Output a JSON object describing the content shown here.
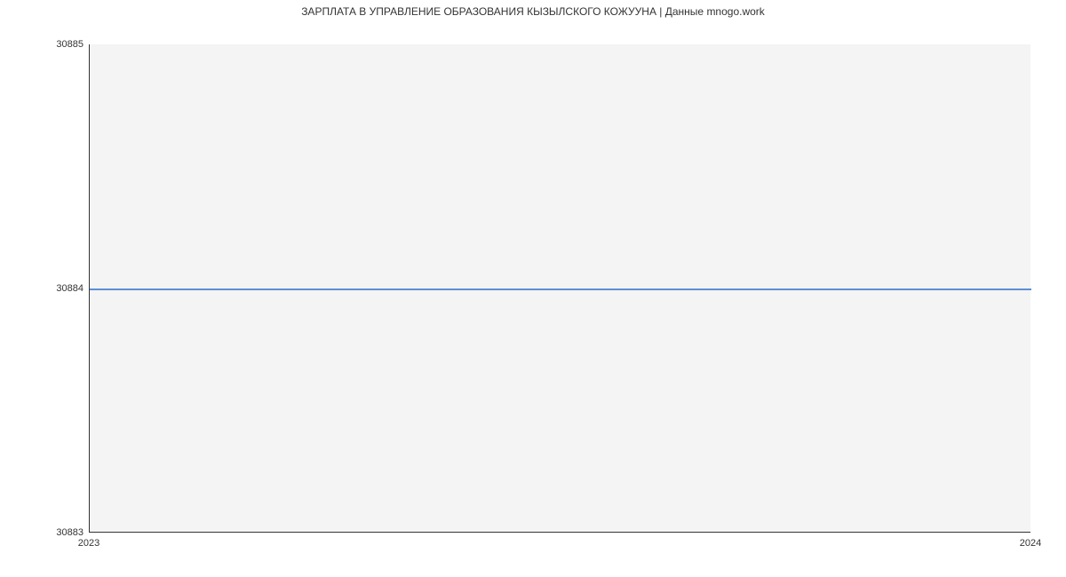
{
  "chart_data": {
    "type": "line",
    "title": "ЗАРПЛАТА В УПРАВЛЕНИЕ ОБРАЗОВАНИЯ КЫЗЫЛСКОГО КОЖУУНА | Данные mnogo.work",
    "xlabel": "",
    "ylabel": "",
    "x": [
      2023,
      2024
    ],
    "values": [
      30884,
      30884
    ],
    "x_ticks": [
      "2023",
      "2024"
    ],
    "y_ticks": [
      "30883",
      "30884",
      "30885"
    ],
    "ylim": [
      30883,
      30885
    ],
    "xlim": [
      2023,
      2024
    ],
    "line_color": "#5b8fd6",
    "plot_bg": "#f4f4f4"
  }
}
